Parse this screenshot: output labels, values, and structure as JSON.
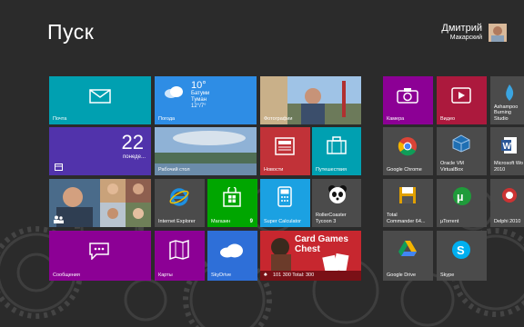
{
  "screen": {
    "title": "Пуск"
  },
  "user": {
    "name": "Дмитрий",
    "surname": "Макарский"
  },
  "colors": {
    "background": "#2b2b2b",
    "teal": "#00a0b1",
    "blue": "#2e8de5",
    "purple": "#8c0095",
    "red": "#c13238",
    "green": "#00a600",
    "gray": "#4b4b4b",
    "cyan": "#1ba1e2",
    "darkred": "#ac193d"
  },
  "tiles": {
    "mail": {
      "label": "Почта",
      "icon": "envelope-icon"
    },
    "weather": {
      "label": "Погода",
      "temp": "10°",
      "city": "Батуми",
      "cond": "Туман",
      "range": "12°/7°",
      "icon": "cloud-icon"
    },
    "photos": {
      "label": "Фотографии"
    },
    "camera": {
      "label": "Камера",
      "icon": "camera-icon"
    },
    "video": {
      "label": "Видео",
      "icon": "play-icon"
    },
    "ashampoo": {
      "label": "Ashampoo\nBurning Studio"
    },
    "calendar": {
      "label": "",
      "day": "22",
      "weekday": "понеде..."
    },
    "desktop": {
      "label": "Рабочий стол"
    },
    "news": {
      "label": "Новости",
      "icon": "newspaper-icon"
    },
    "travel": {
      "label": "Путешествия",
      "icon": "suitcase-icon"
    },
    "chrome": {
      "label": "Google Chrome",
      "icon": "chrome-icon"
    },
    "virtualbox": {
      "label": "Oracle VM\nVirtualBox",
      "icon": "cube-icon"
    },
    "word": {
      "label": "Microsoft Wo\n2010",
      "icon": "word-icon"
    },
    "people": {
      "label": "",
      "icon": "people-icon"
    },
    "ie": {
      "label": "Internet Explorer",
      "icon": "ie-icon"
    },
    "store": {
      "label": "Магазин",
      "badge": "9",
      "icon": "store-icon"
    },
    "calc": {
      "label": "Super Calculator",
      "icon": "calculator-icon"
    },
    "roller": {
      "label": "RollerCoaster\nTycoon 3",
      "icon": "panda-icon"
    },
    "totalcmd": {
      "label": "Total\nCommander 64...",
      "icon": "floppy-icon"
    },
    "utorrent": {
      "label": "µTorrent",
      "icon": "utorrent-icon"
    },
    "delphi": {
      "label": "Delphi 2010"
    },
    "messages": {
      "label": "Сообщения",
      "icon": "chat-icon"
    },
    "maps": {
      "label": "Карты",
      "icon": "map-icon"
    },
    "skydrive": {
      "label": "SkyDrive",
      "icon": "skydrive-icon"
    },
    "cardgames": {
      "title": "Card Games Chest",
      "score": "101 300 Total: 300"
    },
    "gdrive": {
      "label": "Google Drive",
      "icon": "gdrive-icon"
    },
    "skype": {
      "label": "Skype",
      "icon": "skype-icon"
    }
  }
}
